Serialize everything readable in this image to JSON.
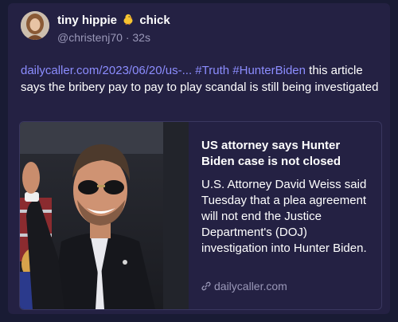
{
  "post": {
    "display_name": "tiny hippie",
    "display_name_suffix": "chick",
    "handle": "@christenj70",
    "separator": "·",
    "timestamp": "32s",
    "link_text": "dailycaller.com/2023/06/20/us-...",
    "hashtag_1": "#Truth",
    "hashtag_2": "#HunterBiden",
    "body_rest": " this article says the bribery pay to pay to play scandal is still being investigated",
    "emoji_icon": "baby-chick-icon"
  },
  "card": {
    "title": "US attorney says Hunter Biden case is not closed",
    "description": "U.S. Attorney David Weiss said Tuesday that a plea agreement will not end the Justice Department's (DOJ) investigation into Hunter Biden.",
    "source": "dailycaller.com",
    "source_icon": "link-icon"
  },
  "colors": {
    "page_background": "#191b34",
    "post_background": "#242143",
    "link": "#8c8dff",
    "muted_text": "#9a98b8"
  }
}
